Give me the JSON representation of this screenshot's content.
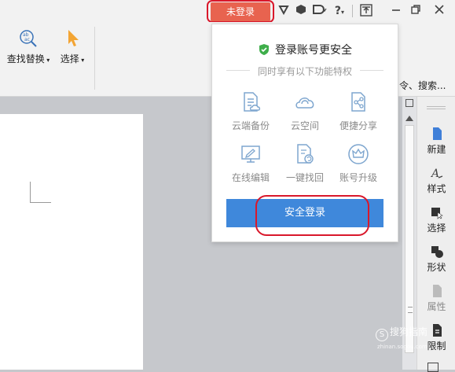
{
  "titlebar": {
    "login_label": "未登录",
    "help_label": "?",
    "icons": [
      "skin-icon",
      "cube-icon",
      "feedback-icon",
      "help-icon",
      "upload-window-icon",
      "minimize-icon",
      "restore-icon",
      "close-icon"
    ]
  },
  "ribbon": {
    "find_replace_label": "查找替换",
    "select_label": "选择",
    "right_truncated": "令、搜索..."
  },
  "popup": {
    "title": "登录账号更安全",
    "subtitle": "同时享有以下功能特权",
    "features": [
      {
        "label": "云端备份",
        "icon": "cloud-backup-icon"
      },
      {
        "label": "云空间",
        "icon": "cloud-space-icon"
      },
      {
        "label": "便捷分享",
        "icon": "share-icon"
      },
      {
        "label": "在线编辑",
        "icon": "online-edit-icon"
      },
      {
        "label": "一键找回",
        "icon": "recover-icon"
      },
      {
        "label": "账号升级",
        "icon": "crown-icon"
      }
    ],
    "login_button": "安全登录"
  },
  "right_panel": {
    "items": [
      {
        "label": "新建",
        "icon": "new-doc-icon",
        "enabled": true
      },
      {
        "label": "样式",
        "icon": "style-icon",
        "enabled": true
      },
      {
        "label": "选择",
        "icon": "select-icon",
        "enabled": true
      },
      {
        "label": "形状",
        "icon": "shape-icon",
        "enabled": true
      },
      {
        "label": "属性",
        "icon": "property-icon",
        "enabled": false
      },
      {
        "label": "限制",
        "icon": "restrict-icon",
        "enabled": true
      }
    ]
  },
  "watermark": {
    "text": "搜狗指南",
    "sub": "zhinan.sogou.com"
  },
  "colors": {
    "login_bg": "#e8634f",
    "highlight_ring": "#d9182b",
    "primary_button": "#3f88db",
    "feature_icon": "#7ea6cf",
    "shield_green": "#3fae4b"
  }
}
